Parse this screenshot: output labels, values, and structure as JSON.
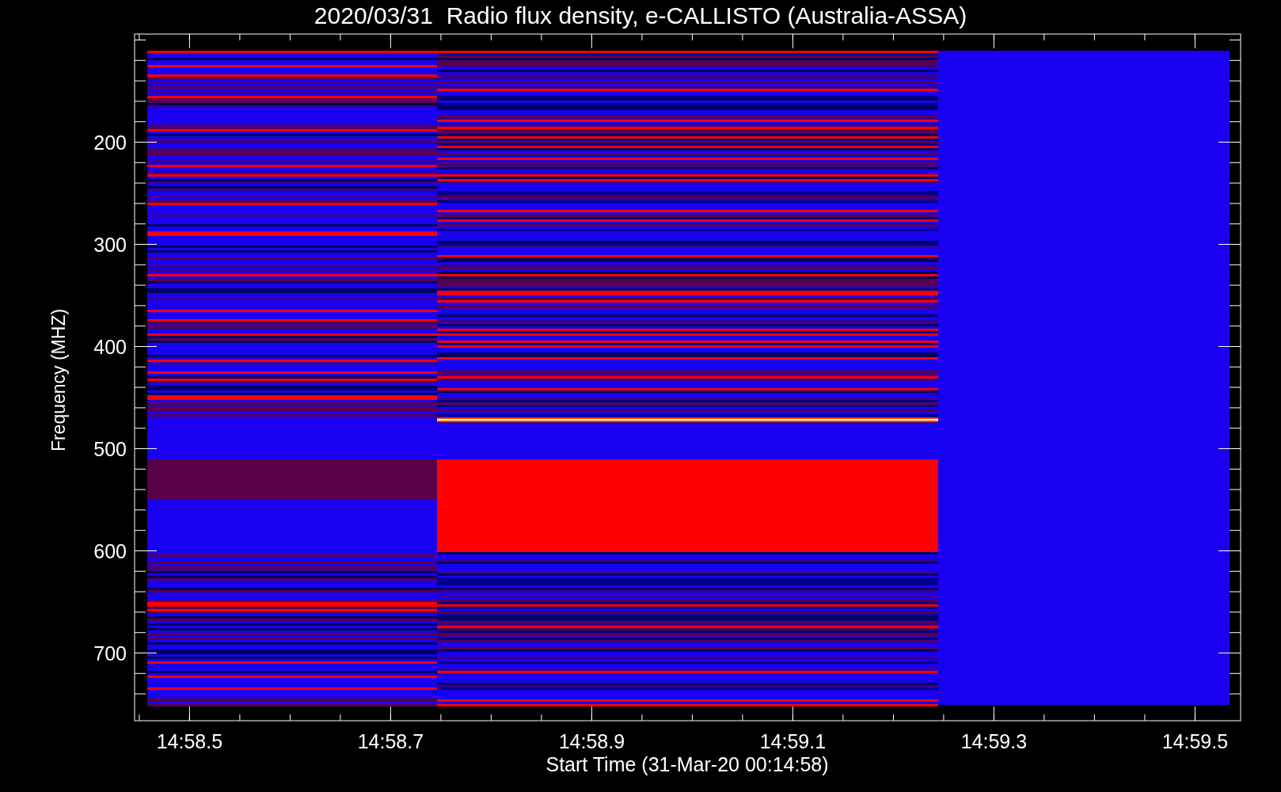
{
  "title": "2020/03/31  Radio flux density, e-CALLISTO (Australia-ASSA)",
  "y_axis": {
    "label": "Frequency (MHZ)",
    "ticks": [
      "200",
      "300",
      "400",
      "500",
      "600",
      "700"
    ]
  },
  "x_axis": {
    "label": "Start Time (31-Mar-20 00:14:58)",
    "ticks": [
      "14:58.5",
      "14:58.7",
      "14:58.9",
      "14:59.1",
      "14:59.3",
      "14:59.5"
    ]
  }
}
